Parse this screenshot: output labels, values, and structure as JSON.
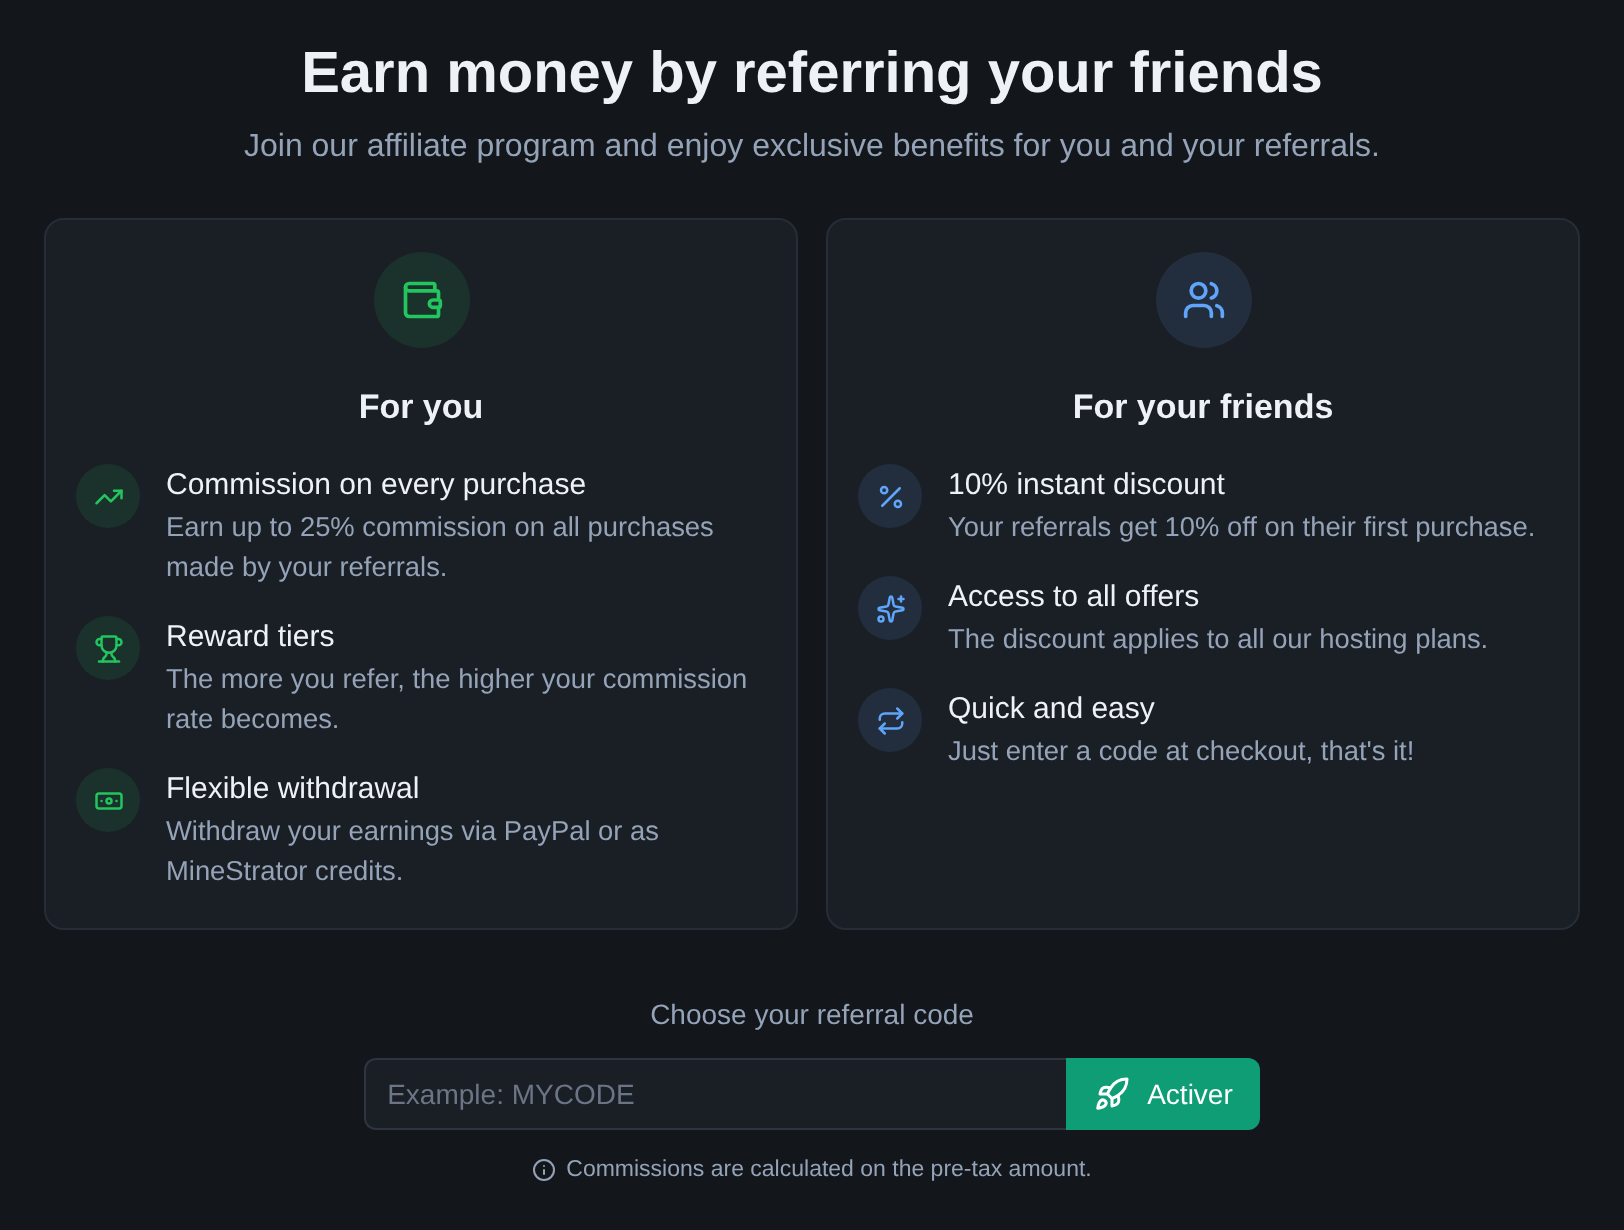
{
  "header": {
    "title": "Earn money by referring your friends",
    "subtitle": "Join our affiliate program and enjoy exclusive benefits for you and your referrals."
  },
  "cards": [
    {
      "title": "For you",
      "color": "#22c55e",
      "benefits": [
        {
          "title": "Commission on every purchase",
          "description": "Earn up to 25% commission on all purchases made by your referrals."
        },
        {
          "title": "Reward tiers",
          "description": "The more you refer, the higher your commission rate becomes."
        },
        {
          "title": "Flexible withdrawal",
          "description": "Withdraw your earnings via PayPal or as MineStrator credits."
        }
      ]
    },
    {
      "title": "For your friends",
      "color": "#60a5fa",
      "benefits": [
        {
          "title": "10% instant discount",
          "description": "Your referrals get 10% off on their first purchase."
        },
        {
          "title": "Access to all offers",
          "description": "The discount applies to all our hosting plans."
        },
        {
          "title": "Quick and easy",
          "description": "Just enter a code at checkout, that's it!"
        }
      ]
    }
  ],
  "referral": {
    "label": "Choose your referral code",
    "code_field": {
      "placeholder": "Example: MYCODE"
    },
    "submit_button": "Activer",
    "note": "Commissions are calculated on the pre-tax amount."
  }
}
